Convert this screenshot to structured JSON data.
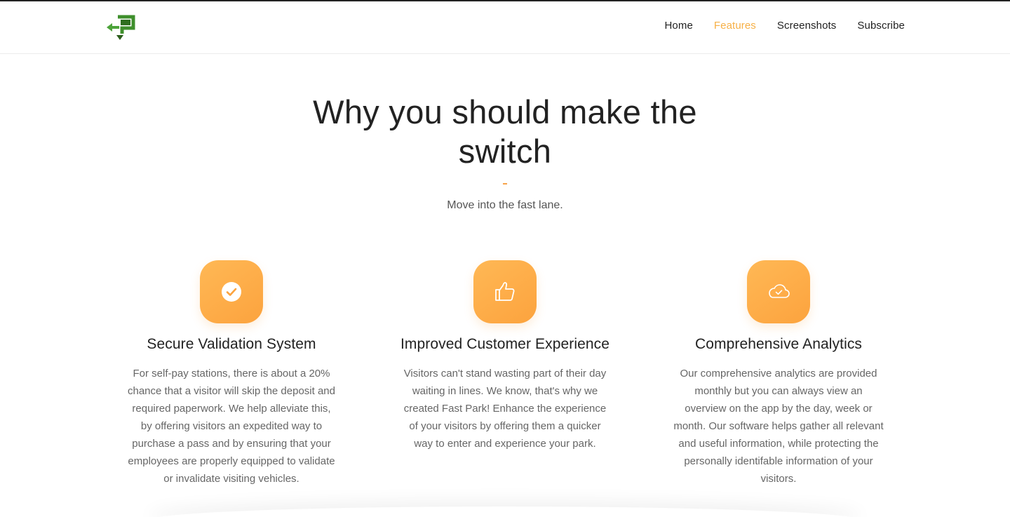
{
  "nav": {
    "items": [
      {
        "label": "Home",
        "active": false
      },
      {
        "label": "Features",
        "active": true
      },
      {
        "label": "Screenshots",
        "active": false
      },
      {
        "label": "Subscribe",
        "active": false
      }
    ]
  },
  "hero": {
    "title": "Why you should make the switch",
    "subtitle": "Move into the fast lane."
  },
  "features": [
    {
      "icon": "check-circle-icon",
      "title": "Secure Validation System",
      "text": "For self-pay stations, there is about a 20% chance that a visitor will skip the deposit and required paperwork. We help alleviate this, by offering visitors an expedited way to purchase a pass and by ensuring that your employees are properly equipped to validate or invalidate visiting vehicles."
    },
    {
      "icon": "thumbs-up-icon",
      "title": "Improved Customer Experience",
      "text": "Visitors can't stand wasting part of their day waiting in lines. We know, that's why we created Fast Park! Enhance the experience of your visitors by offering them a quicker way to enter and experience your park."
    },
    {
      "icon": "cloud-check-icon",
      "title": "Comprehensive Analytics",
      "text": "Our comprehensive analytics are provided monthly but you can always view an overview on the app by the day, week or month. Our software helps gather all relevant and useful information, while protecting the personally identifable information of your visitors."
    }
  ],
  "colors": {
    "accent": "#f7b046",
    "icon_gradient_start": "#ffb855",
    "icon_gradient_end": "#fca33e",
    "logo_green": "#3f8f2c"
  }
}
